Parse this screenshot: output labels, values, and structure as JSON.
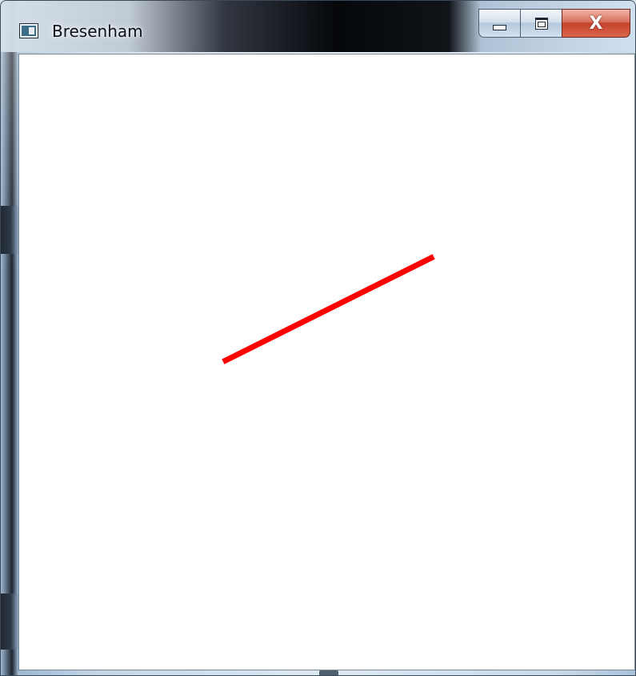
{
  "window": {
    "title": "Bresenham",
    "icon": "app-window-icon",
    "controls": {
      "minimize_icon": "minimize-icon",
      "maximize_icon": "maximize-icon",
      "close_label": "X"
    }
  },
  "canvas": {
    "background": "#ffffff",
    "line_color": "#ff0000"
  }
}
